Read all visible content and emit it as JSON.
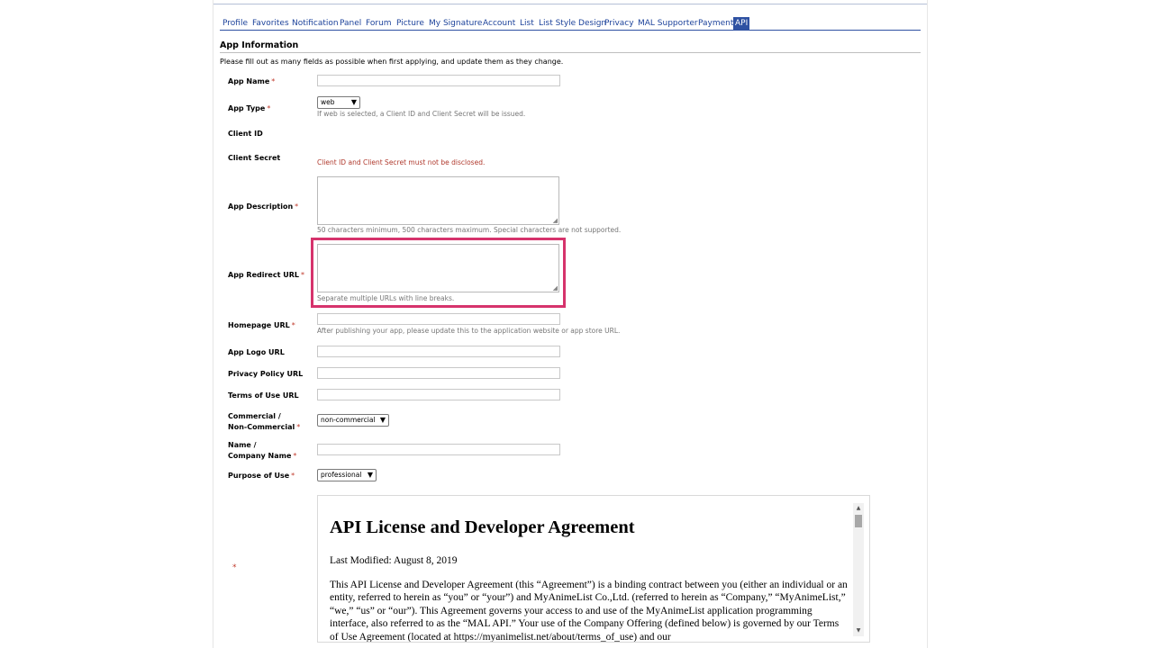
{
  "tabs": [
    {
      "label": "Profile",
      "active": false
    },
    {
      "label": "Favorites",
      "active": false
    },
    {
      "label": "Notification",
      "active": false
    },
    {
      "label": "Panel",
      "active": false
    },
    {
      "label": "Forum",
      "active": false
    },
    {
      "label": "Picture",
      "active": false
    },
    {
      "label": "My Signature",
      "active": false
    },
    {
      "label": "Account",
      "active": false
    },
    {
      "label": "List",
      "active": false
    },
    {
      "label": "List Style Design",
      "active": false
    },
    {
      "label": "Privacy",
      "active": false
    },
    {
      "label": "MAL Supporter",
      "active": false
    },
    {
      "label": "Payment",
      "active": false
    },
    {
      "label": "API",
      "active": true
    }
  ],
  "section": {
    "title": "App Information",
    "intro": "Please fill out as many fields as possible when first applying, and update them as they change."
  },
  "required_mark": "*",
  "fields": {
    "app_name": {
      "label": "App Name",
      "value": ""
    },
    "app_type": {
      "label": "App Type",
      "selected": "web",
      "hint": "If web is selected, a Client ID and Client Secret will be issued."
    },
    "client_id": {
      "label": "Client ID"
    },
    "client_secret": {
      "label": "Client Secret",
      "hint": "Client ID and Client Secret must not be disclosed."
    },
    "app_description": {
      "label": "App Description",
      "value": "",
      "hint": "50 characters minimum, 500 characters maximum. Special characters are not supported."
    },
    "app_redirect_url": {
      "label": "App Redirect URL",
      "value": "",
      "hint": "Separate multiple URLs with line breaks."
    },
    "homepage_url": {
      "label": "Homepage URL",
      "value": "",
      "hint": "After publishing your app, please update this to the application website or app store URL."
    },
    "app_logo_url": {
      "label": "App Logo URL",
      "value": ""
    },
    "privacy_policy_url": {
      "label": "Privacy Policy URL",
      "value": ""
    },
    "terms_of_use_url": {
      "label": "Terms of Use URL",
      "value": ""
    },
    "commercial": {
      "label_line1": "Commercial /",
      "label_line2": "Non-Commercial",
      "selected": "non-commercial"
    },
    "company_name": {
      "label_line1": "Name /",
      "label_line2": "Company Name",
      "value": ""
    },
    "purpose_of_use": {
      "label": "Purpose of Use",
      "selected": "professional"
    }
  },
  "agreement": {
    "title": "API License and Developer Agreement",
    "modified": "Last Modified: August 8, 2019",
    "paragraph": "This API License and Developer Agreement (this “Agreement”) is a binding contract between you (either an individual or an entity, referred to herein as “you” or “your”) and MyAnimeList Co.,Ltd. (referred to herein as “Company,” “MyAnimeList,” “we,” “us” or “our”). This Agreement governs your access to and use of the MyAnimeList application programming interface, also referred to as the “MAL API.” Your use of the Company Offering (defined below) is governed by our Terms of Use Agreement (located at https://myanimelist.net/about/terms_of_use) and our"
  },
  "colors": {
    "link": "#1d439b",
    "tab_active_bg": "#2e51a2",
    "required": "#c0392b",
    "highlight": "#d6336c"
  }
}
